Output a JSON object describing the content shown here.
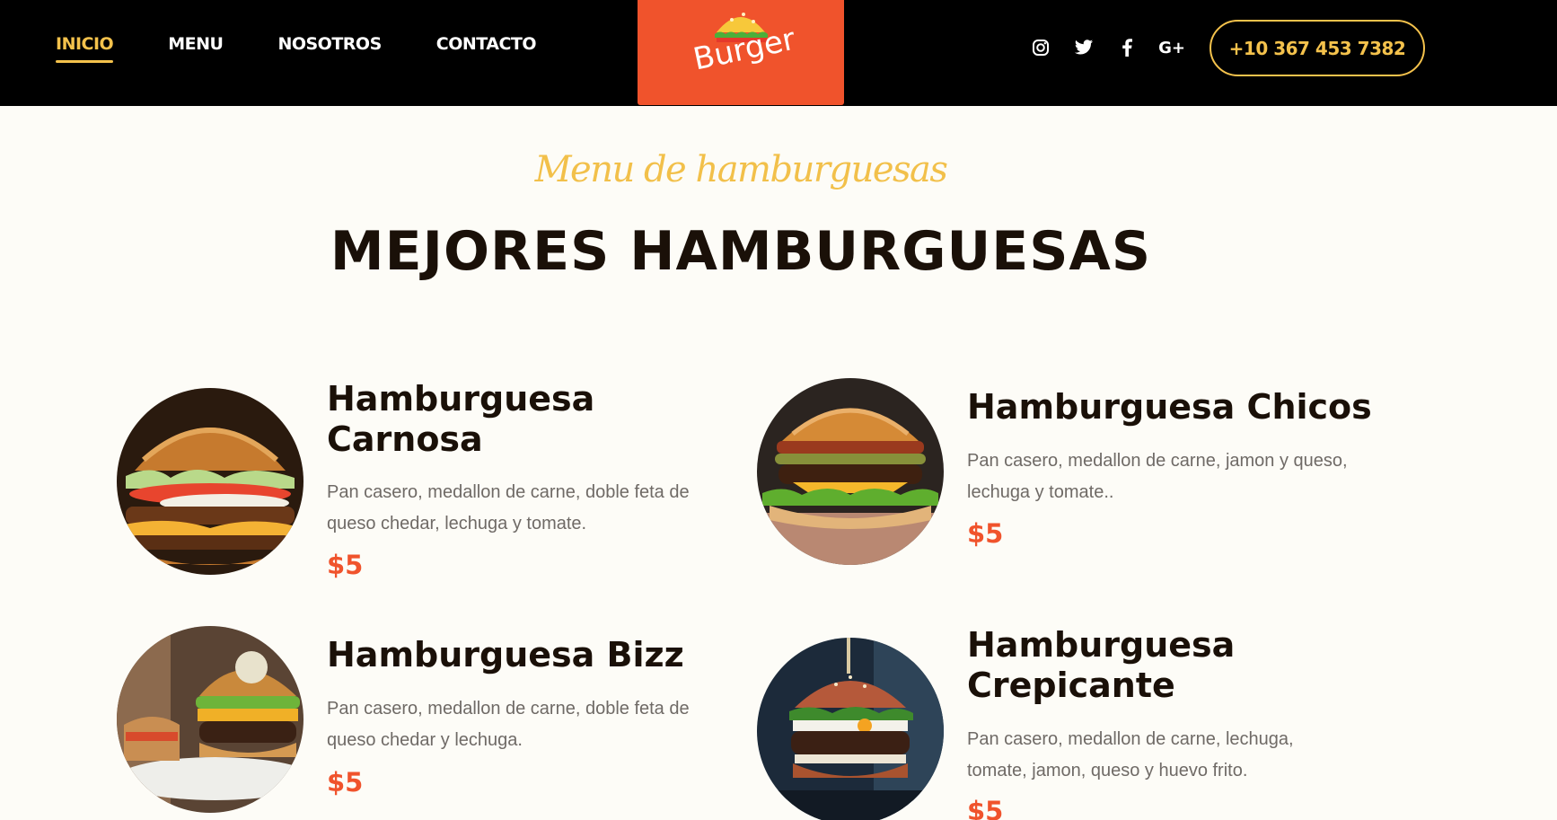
{
  "nav": {
    "items": [
      {
        "label": "INICIO",
        "active": true
      },
      {
        "label": "MENU",
        "active": false
      },
      {
        "label": "NOSOTROS",
        "active": false
      },
      {
        "label": "CONTACTO",
        "active": false
      }
    ]
  },
  "logo": {
    "text": "Burger",
    "background": "#f0532c"
  },
  "social": [
    "instagram-icon",
    "twitter-icon",
    "facebook-icon",
    "google-plus-icon"
  ],
  "social_gplus_label": "G+",
  "phone": "+10 367 453 7382",
  "section": {
    "kicker": "Menu de hamburguesas",
    "heading": "MEJORES HAMBURGUESAS"
  },
  "menu": [
    {
      "title": "Hamburguesa Carnosa",
      "description": "Pan casero, medallon de carne, doble feta de queso chedar, lechuga y tomate.",
      "price": "$5"
    },
    {
      "title": "Hamburguesa Chicos",
      "description": "Pan casero, medallon de carne, jamon y queso, lechuga y tomate..",
      "price": "$5"
    },
    {
      "title": "Hamburguesa Bizz",
      "description": "Pan casero, medallon de carne, doble feta de queso chedar y lechuga.",
      "price": "$5"
    },
    {
      "title": "Hamburguesa Crepicante",
      "description": "Pan casero, medallon de carne, lechuga, tomate, jamon, queso y huevo frito.",
      "price": "$5"
    }
  ],
  "colors": {
    "accent": "#f0532c",
    "gold": "#f4c24c",
    "header": "#000000",
    "background": "#fdfcf7"
  }
}
